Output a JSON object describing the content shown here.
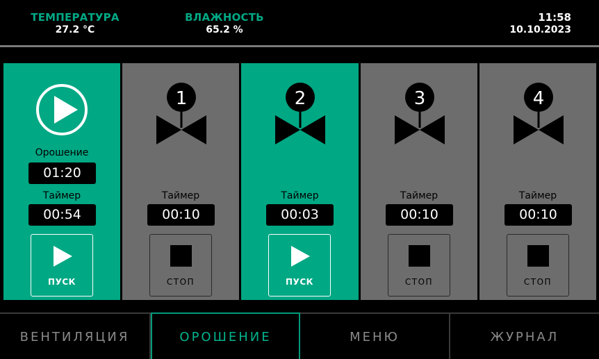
{
  "header": {
    "temperature_label": "ТЕМПЕРАТУРА",
    "temperature_value": "27.2 °C",
    "humidity_label": "ВЛАЖНОСТЬ",
    "humidity_value": "65.2 %",
    "time": "11:58",
    "date": "10.10.2023"
  },
  "colors": {
    "accent": "#00a884",
    "panel_inactive": "#6d6d6d",
    "background": "#000000"
  },
  "master": {
    "icon": "play-circle-icon",
    "irrigation_label": "Орошение",
    "irrigation_value": "01:20",
    "timer_label": "Таймер",
    "timer_value": "00:54",
    "button_label": "ПУСК",
    "button_icon": "play-icon",
    "active": true
  },
  "zones": [
    {
      "number": "1",
      "timer_label": "Таймер",
      "timer_value": "00:10",
      "button_label": "СТОП",
      "button_icon": "stop-icon",
      "active": false
    },
    {
      "number": "2",
      "timer_label": "Таймер",
      "timer_value": "00:03",
      "button_label": "ПУСК",
      "button_icon": "play-icon",
      "active": true
    },
    {
      "number": "3",
      "timer_label": "Таймер",
      "timer_value": "00:10",
      "button_label": "СТОП",
      "button_icon": "stop-icon",
      "active": false
    },
    {
      "number": "4",
      "timer_label": "Таймер",
      "timer_value": "00:10",
      "button_label": "СТОП",
      "button_icon": "stop-icon",
      "active": false
    }
  ],
  "nav": {
    "tabs": [
      {
        "label": "ВЕНТИЛЯЦИЯ",
        "active": false
      },
      {
        "label": "ОРОШЕНИЕ",
        "active": true
      },
      {
        "label": "МЕНЮ",
        "active": false
      },
      {
        "label": "ЖУРНАЛ",
        "active": false
      }
    ]
  }
}
